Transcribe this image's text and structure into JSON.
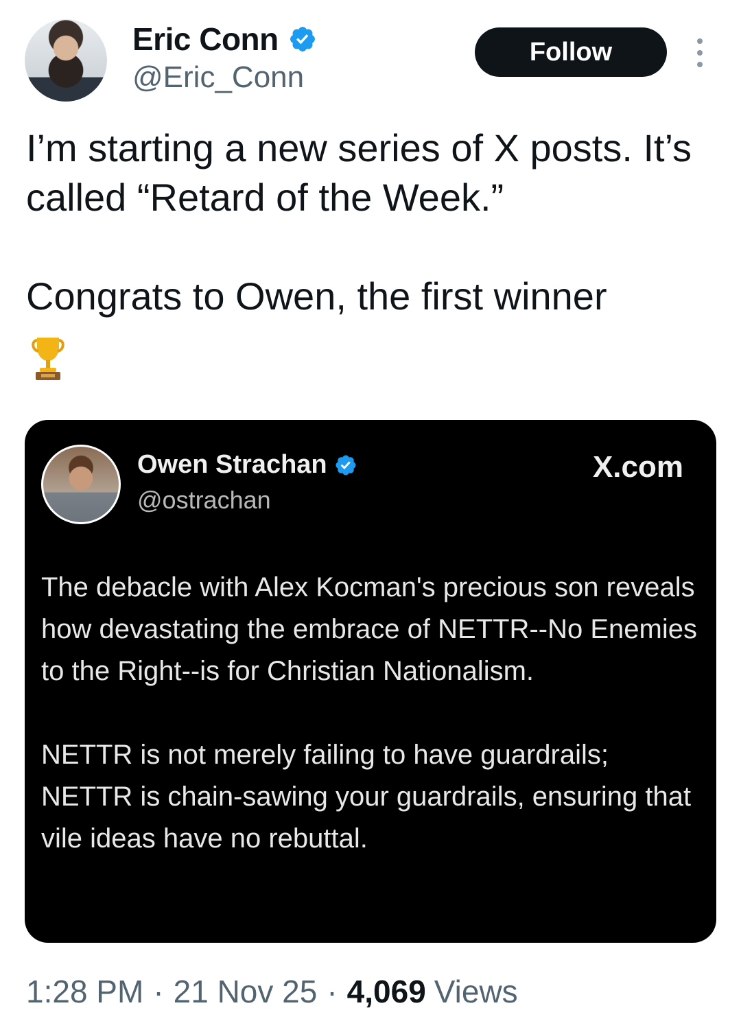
{
  "author": {
    "display_name": "Eric Conn",
    "handle": "@Eric_Conn",
    "verified_icon": "verified-badge-icon"
  },
  "actions": {
    "follow_label": "Follow",
    "more_icon": "more-options-icon"
  },
  "post": {
    "text": "I’m starting a new series of X posts. It’s called “Retard of the Week.”\n\nCongrats to Owen, the first winner",
    "emoji": "trophy-icon"
  },
  "quoted": {
    "display_name": "Owen Strachan",
    "handle": "@ostrachan",
    "site": "X.com",
    "text": "The debacle with Alex Kocman's precious son reveals how devastating the embrace of NETTR--No Enemies to the Right--is for Christian Nationalism.\n\nNETTR is not merely failing to have guardrails; NETTR is chain-sawing your guardrails, ensuring that vile ideas have no rebuttal."
  },
  "meta": {
    "time": "1:28 PM",
    "date": "21 Nov 25",
    "views_count": "4,069",
    "views_label": "Views",
    "separator": "·"
  },
  "colors": {
    "verified_blue": "#1d9bf0",
    "text_primary": "#0f1419",
    "text_secondary": "#536471",
    "follow_bg": "#0f1419"
  }
}
